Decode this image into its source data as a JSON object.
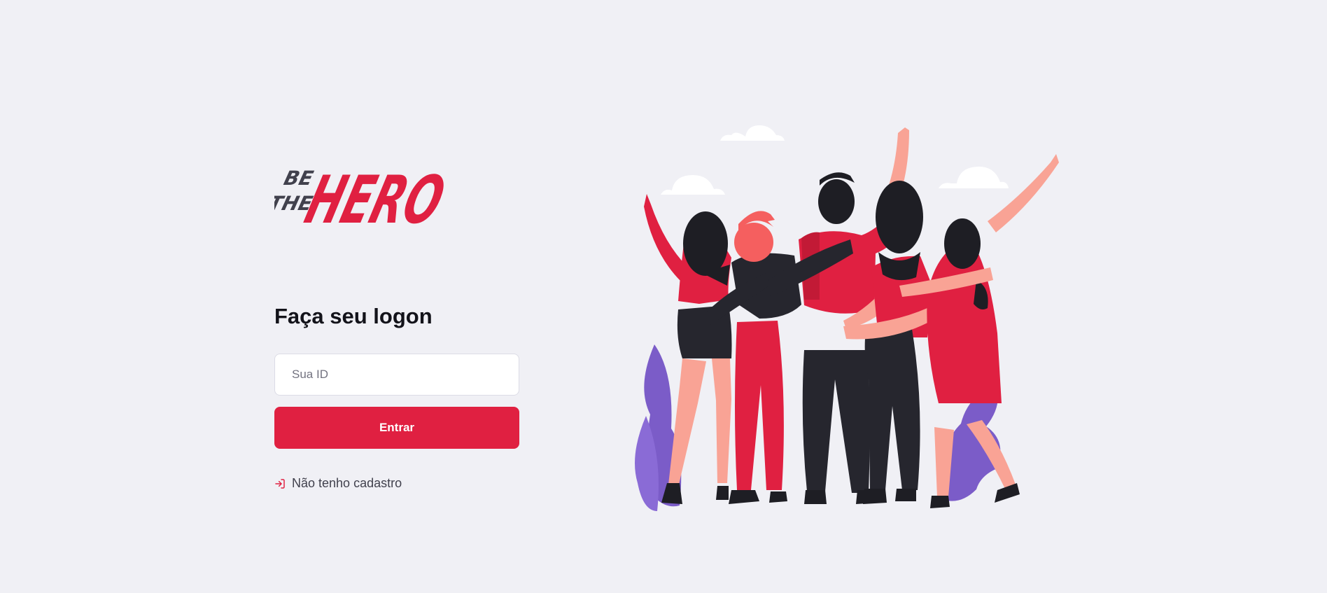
{
  "logo": {
    "line1": "BE",
    "line2": "THE",
    "word": "HERO",
    "alt": "Be The Hero"
  },
  "login": {
    "title": "Faça seu logon",
    "id_placeholder": "Sua ID",
    "id_value": "",
    "submit_label": "Entrar",
    "register_label": "Não tenho cadastro"
  },
  "colors": {
    "accent": "#e02041",
    "background": "#f0f0f5",
    "text_dark": "#13131a",
    "text_muted": "#41414d"
  },
  "icons": {
    "register": "log-in-icon"
  }
}
